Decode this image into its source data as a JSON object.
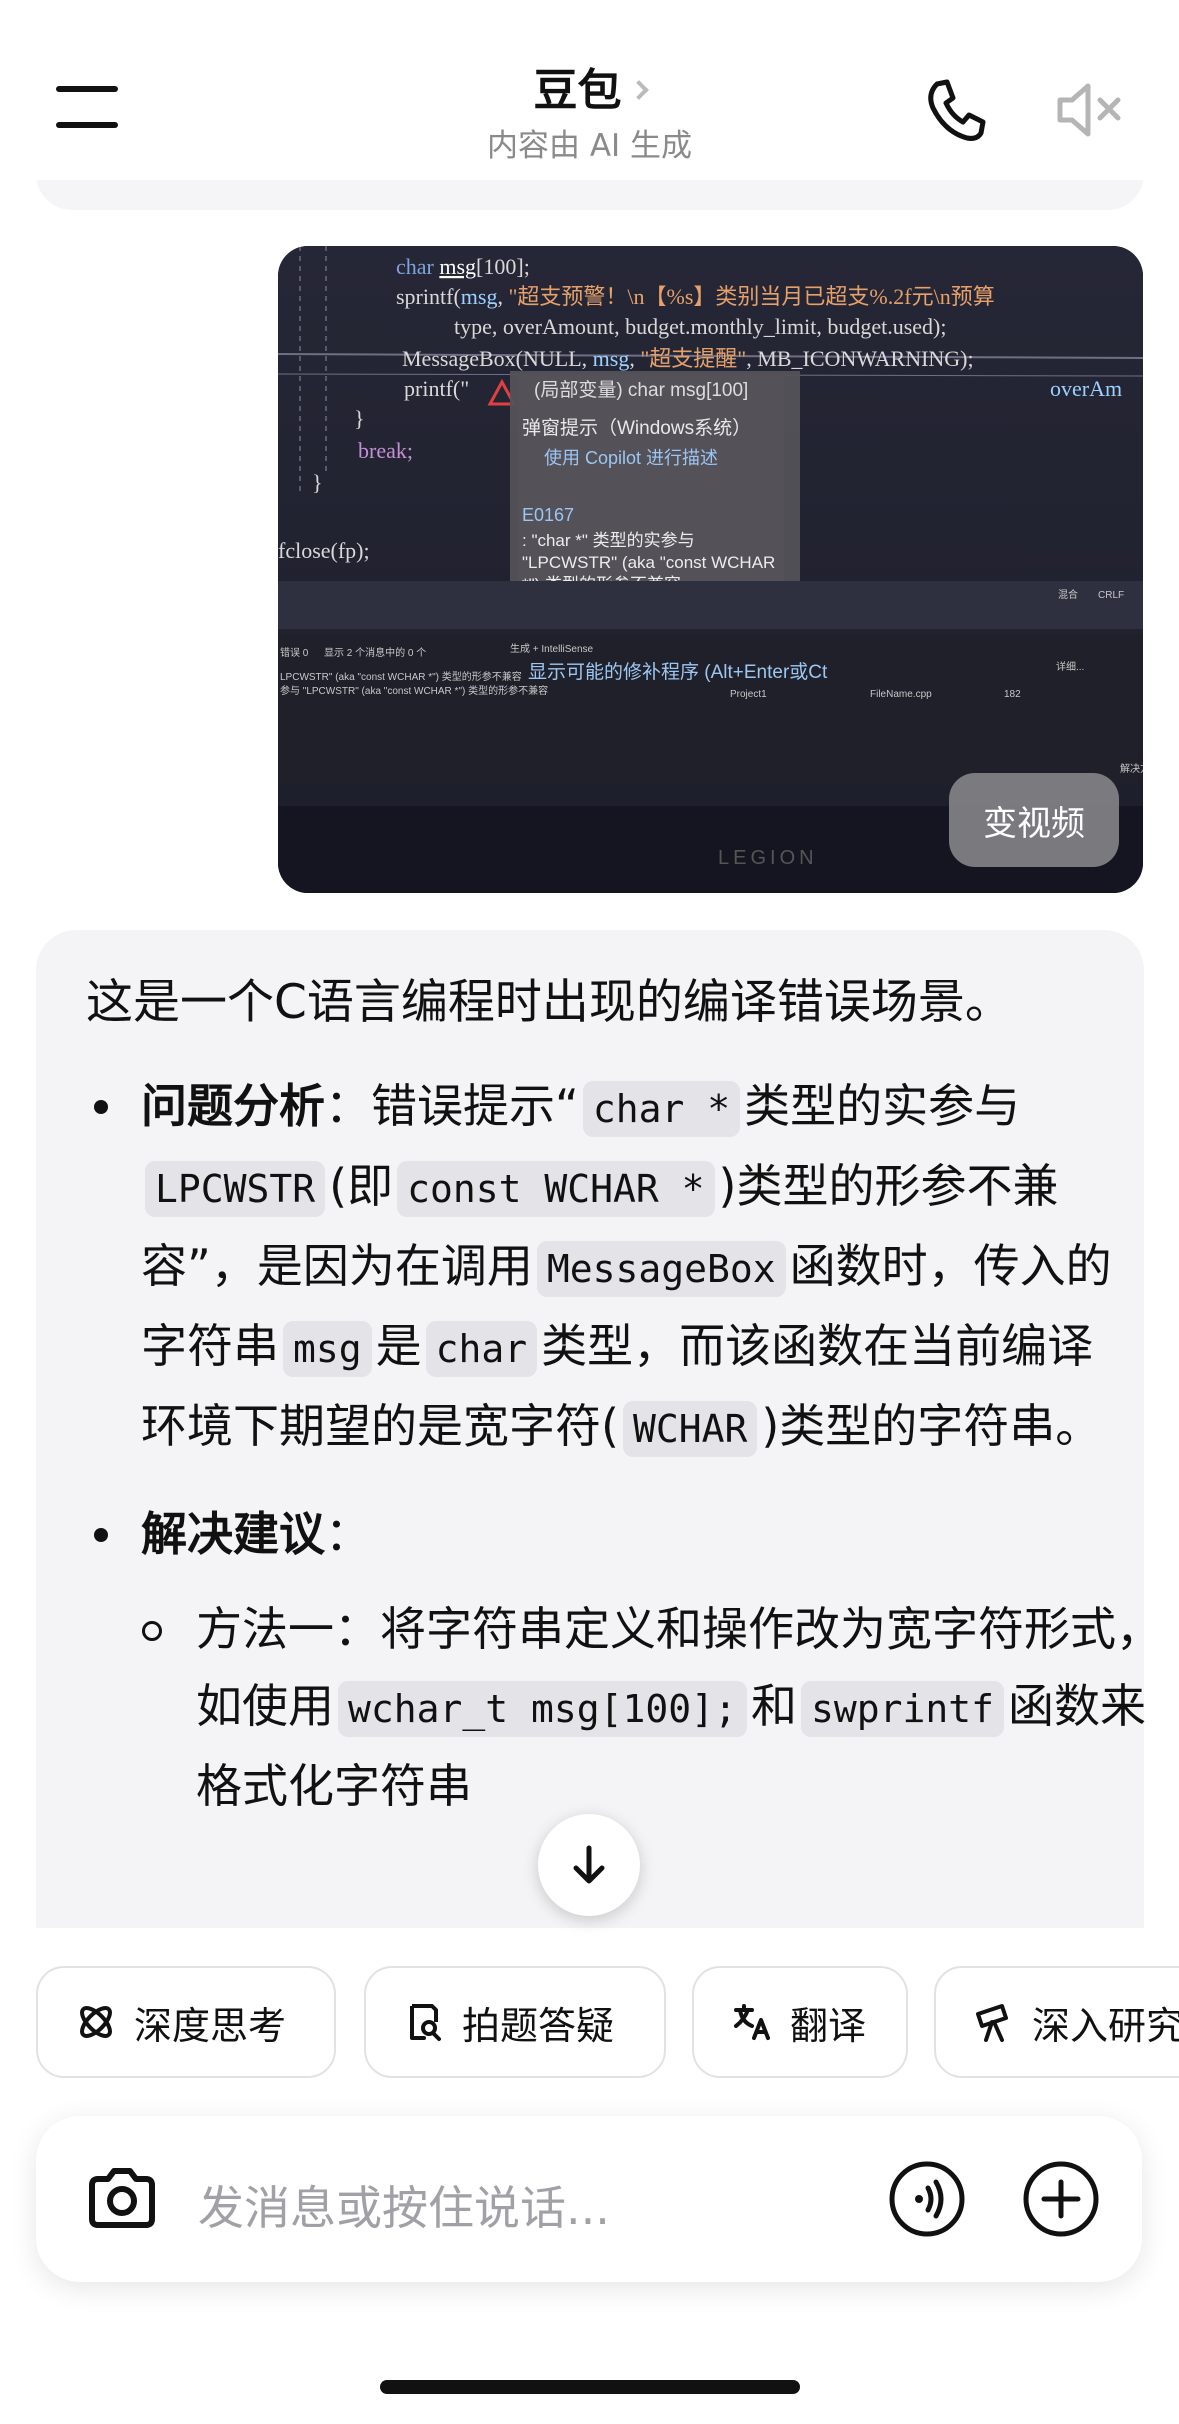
{
  "header": {
    "title": "豆包",
    "subtitle": "内容由 AI 生成"
  },
  "user_image": {
    "video_button_label": "变视频",
    "code_lines": [
      "char msg[100];",
      "sprintf(msg, \"超支预警！\\n【%s】类别当月已超支%.2f元\\n预算",
      "type, overAmount, budget.monthly_limit, budget.used);",
      "MessageBox(NULL, msg, \"超支提醒\", MB_ICONWARNING);",
      "printf(\"",
      "}",
      "break;",
      "}",
      "fclose(fp);"
    ],
    "overflow_fragment": "overAm",
    "tooltip": {
      "var_line": "(局部变量) char msg[100]",
      "line2": "弹窗提示（Windows系统）",
      "copilot": "使用 Copilot 进行描述",
      "code": "E0167",
      "error_lines": [
        ": \"char *\" 类型的实参与",
        "\"LPCWSTR\" (aka \"const WCHAR",
        "*\") 类型的形参不兼容"
      ],
      "fix": "显示可能的修补程序 (Alt+Enter或Ct"
    },
    "status_bar": {
      "errors": "错误 0",
      "messages": "显示 2 个消息中的 0 个",
      "build": "生成 + IntelliSense",
      "mixed": "混合",
      "crlf": "CRLF",
      "detail": "详细...",
      "project": "Project1",
      "file": "FileName.cpp",
      "line": "182",
      "row1": "LPCWSTR\" (aka \"const WCHAR *\") 类型的形参不兼容",
      "row2": "参与 \"LPCWSTR\" (aka \"const WCHAR *\") 类型的形参不兼容",
      "corner": "解决方"
    },
    "monitor_brand": "LEGION"
  },
  "reply": {
    "intro": "这是一个C语言编程时出现的编译错误场景。",
    "analysis": {
      "title": "问题分析",
      "colon": "：",
      "t1": "错误提示“",
      "c1": "char *",
      "t2": "类型的实参与",
      "c2": "LPCWSTR",
      "t3": "(即",
      "c3": "const WCHAR *",
      "t4": ")类型的形参不兼容”，是因为在调用",
      "c4": "MessageBox",
      "t5": "函数时，传入的字符串",
      "c5": "msg",
      "t6": "是",
      "c6": "char",
      "t7": "类型，而该函数在当前编译环境下期望的是宽字符(",
      "c7": "WCHAR",
      "t8": ")类型的字符串。"
    },
    "suggestion": {
      "title": "解决建议",
      "colon": "：",
      "method1_text": "方法一：将字符串定义和操作改为宽字符形式，如使用",
      "method1_code": "wchar_t msg[100];",
      "method1_tail": "和",
      "method1_code2": "swprintf",
      "method1_tail2": "函数来格式化字符串"
    }
  },
  "chips": [
    {
      "label": "深度思考",
      "icon": "atom-icon"
    },
    {
      "label": "拍题答疑",
      "icon": "doc-search-icon"
    },
    {
      "label": "翻译",
      "icon": "translate-icon"
    },
    {
      "label": "深入研究",
      "icon": "telescope-icon"
    }
  ],
  "input": {
    "placeholder": "发消息或按住说话..."
  }
}
